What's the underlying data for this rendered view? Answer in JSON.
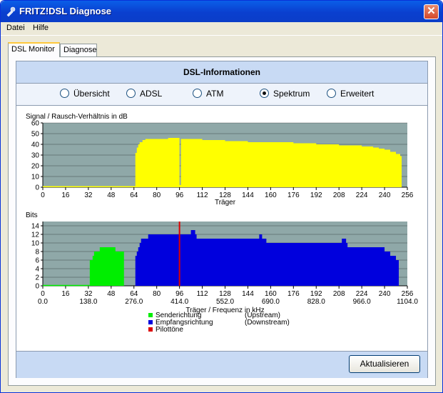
{
  "window": {
    "title": "FRITZ!DSL Diagnose",
    "close_glyph": "✕"
  },
  "menu": {
    "items": [
      "Datei",
      "Hilfe"
    ]
  },
  "tabs": [
    "DSL Monitor",
    "Diagnose"
  ],
  "header": {
    "title": "DSL-Informationen"
  },
  "radios": [
    {
      "label": "Übersicht",
      "selected": false
    },
    {
      "label": "ADSL",
      "selected": false
    },
    {
      "label": "ATM",
      "selected": false
    },
    {
      "label": "Spektrum",
      "selected": true
    },
    {
      "label": "Erweitert",
      "selected": false
    }
  ],
  "colors": {
    "snr": "#ffff00",
    "upstream": "#00ee00",
    "downstream": "#0000dd",
    "pilot": "#dd0000",
    "plot_bg": "#8fa8a8"
  },
  "chart_data": [
    {
      "type": "bar",
      "title": "Signal / Rausch-Verhältnis in dB",
      "xlabel": "Träger",
      "ylabel": "",
      "xlim": [
        0,
        256
      ],
      "ylim": [
        0,
        60
      ],
      "x_ticks": [
        0,
        16,
        32,
        48,
        64,
        80,
        96,
        112,
        128,
        144,
        160,
        176,
        192,
        208,
        224,
        240,
        256
      ],
      "y_ticks": [
        0,
        10,
        20,
        30,
        40,
        50,
        60
      ],
      "grid": true,
      "series": [
        {
          "values_by_carrier": [
            [
              0,
              1
            ],
            [
              64,
              1
            ],
            [
              65,
              32
            ],
            [
              66,
              37
            ],
            [
              67,
              40
            ],
            [
              68,
              42
            ],
            [
              70,
              44
            ],
            [
              72,
              45
            ],
            [
              76,
              45
            ],
            [
              80,
              45
            ],
            [
              88,
              46
            ],
            [
              95,
              46
            ],
            [
              96,
              2
            ],
            [
              97,
              45
            ],
            [
              112,
              44
            ],
            [
              128,
              43
            ],
            [
              144,
              42
            ],
            [
              160,
              42
            ],
            [
              176,
              41
            ],
            [
              192,
              40
            ],
            [
              208,
              39
            ],
            [
              224,
              38
            ],
            [
              232,
              37
            ],
            [
              236,
              36
            ],
            [
              240,
              35
            ],
            [
              244,
              33
            ],
            [
              248,
              31
            ],
            [
              251,
              29
            ],
            [
              252,
              0
            ]
          ]
        }
      ]
    },
    {
      "type": "bar",
      "title": "Bits",
      "xlabel": "Träger / Frequenz in kHz",
      "ylabel": "",
      "xlim": [
        0,
        256
      ],
      "ylim": [
        0,
        15
      ],
      "x_ticks": [
        0,
        16,
        32,
        48,
        64,
        80,
        96,
        112,
        128,
        144,
        160,
        176,
        192,
        208,
        224,
        240,
        256
      ],
      "freq_labels": [
        "0.0",
        "138.0",
        "276.0",
        "414.0",
        "552.0",
        "690.0",
        "828.0",
        "966.0",
        "1104.0"
      ],
      "y_ticks": [
        0,
        2,
        4,
        6,
        8,
        10,
        12,
        14
      ],
      "grid": true,
      "series": [
        {
          "name": "Senderichtung",
          "direction": "(Upstream)",
          "segments": [
            [
              33,
              0
            ],
            [
              33,
              6
            ],
            [
              35,
              7
            ],
            [
              36,
              8
            ],
            [
              40,
              9
            ],
            [
              51,
              8
            ],
            [
              57,
              0
            ]
          ]
        },
        {
          "name": "Empfangsrichtung",
          "direction": "(Downstream)",
          "segments": [
            [
              64,
              0
            ],
            [
              65,
              7
            ],
            [
              66,
              8
            ],
            [
              67,
              9
            ],
            [
              68,
              10
            ],
            [
              69,
              11
            ],
            [
              74,
              12
            ],
            [
              100,
              12
            ],
            [
              104,
              13
            ],
            [
              107,
              12
            ],
            [
              108,
              11
            ],
            [
              150,
              11
            ],
            [
              152,
              12
            ],
            [
              154,
              11
            ],
            [
              157,
              10
            ],
            [
              205,
              10
            ],
            [
              210,
              11
            ],
            [
              213,
              10
            ],
            [
              214,
              9
            ],
            [
              238,
              9
            ],
            [
              240,
              8
            ],
            [
              244,
              7
            ],
            [
              248,
              6
            ],
            [
              250,
              0
            ]
          ]
        },
        {
          "name": "Pilottöne",
          "direction": "",
          "pilot_carrier": 96
        }
      ]
    }
  ],
  "footer": {
    "button": "Aktualisieren"
  }
}
